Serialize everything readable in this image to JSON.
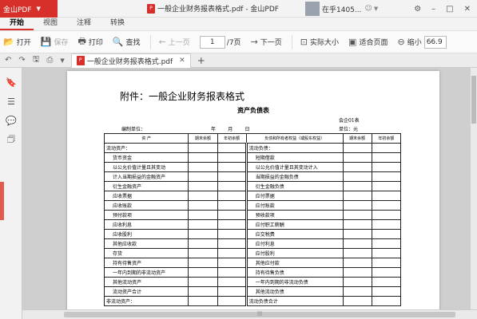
{
  "app": {
    "logo": "金山PDF",
    "window_title": "一般企业财务报表格式.pdf - 金山PDF",
    "user": "在乎1405..."
  },
  "menu": {
    "tabs": [
      "开始",
      "视图",
      "注释",
      "转换"
    ]
  },
  "toolbar": {
    "open": "打开",
    "save": "保存",
    "print": "打印",
    "find": "查找",
    "prev": "上一页",
    "page_value": "1",
    "page_total": "/7页",
    "next": "下一页",
    "actual_size": "实际大小",
    "fit_page": "适合页面",
    "zoom_out": "缩小",
    "zoom_value": "66.9"
  },
  "doctab": {
    "name": "一般企业财务报表格式.pdf"
  },
  "document": {
    "heading": "附件：一般企业财务报表格式",
    "subtitle": "资产负债表",
    "form_no": "会企01表",
    "unit_label": "编制单位：",
    "date_line": "年        月        日",
    "currency": "单位：元",
    "headers": [
      "资    产",
      "期末余额",
      "年初余额",
      "负债和所有者权益（或股东权益）",
      "期末余额",
      "年初余额"
    ],
    "rows": [
      [
        "流动资产：",
        "流动负债："
      ],
      [
        "货币资金",
        "短期借款"
      ],
      [
        "以公允价值计量且其变动",
        "以公允价值计量且其变动计入"
      ],
      [
        "计入当期损益的金融资产",
        "当期损益的金融负债"
      ],
      [
        "衍生金融资产",
        "衍生金融负债"
      ],
      [
        "应收票据",
        "应付票据"
      ],
      [
        "应收账款",
        "应付账款"
      ],
      [
        "预付款项",
        "预收款项"
      ],
      [
        "应收利息",
        "应付职工薪酬"
      ],
      [
        "应收股利",
        "应交税费"
      ],
      [
        "其他应收款",
        "应付利息"
      ],
      [
        "存货",
        "应付股利"
      ],
      [
        "持有待售资产",
        "其他应付款"
      ],
      [
        "一年内到期的非流动资产",
        "持有待售负债"
      ],
      [
        "其他流动资产",
        "一年内到期的非流动负债"
      ],
      [
        "流动资产合计",
        "其他流动负债"
      ],
      [
        "非流动资产：",
        "流动负债合计"
      ]
    ]
  }
}
